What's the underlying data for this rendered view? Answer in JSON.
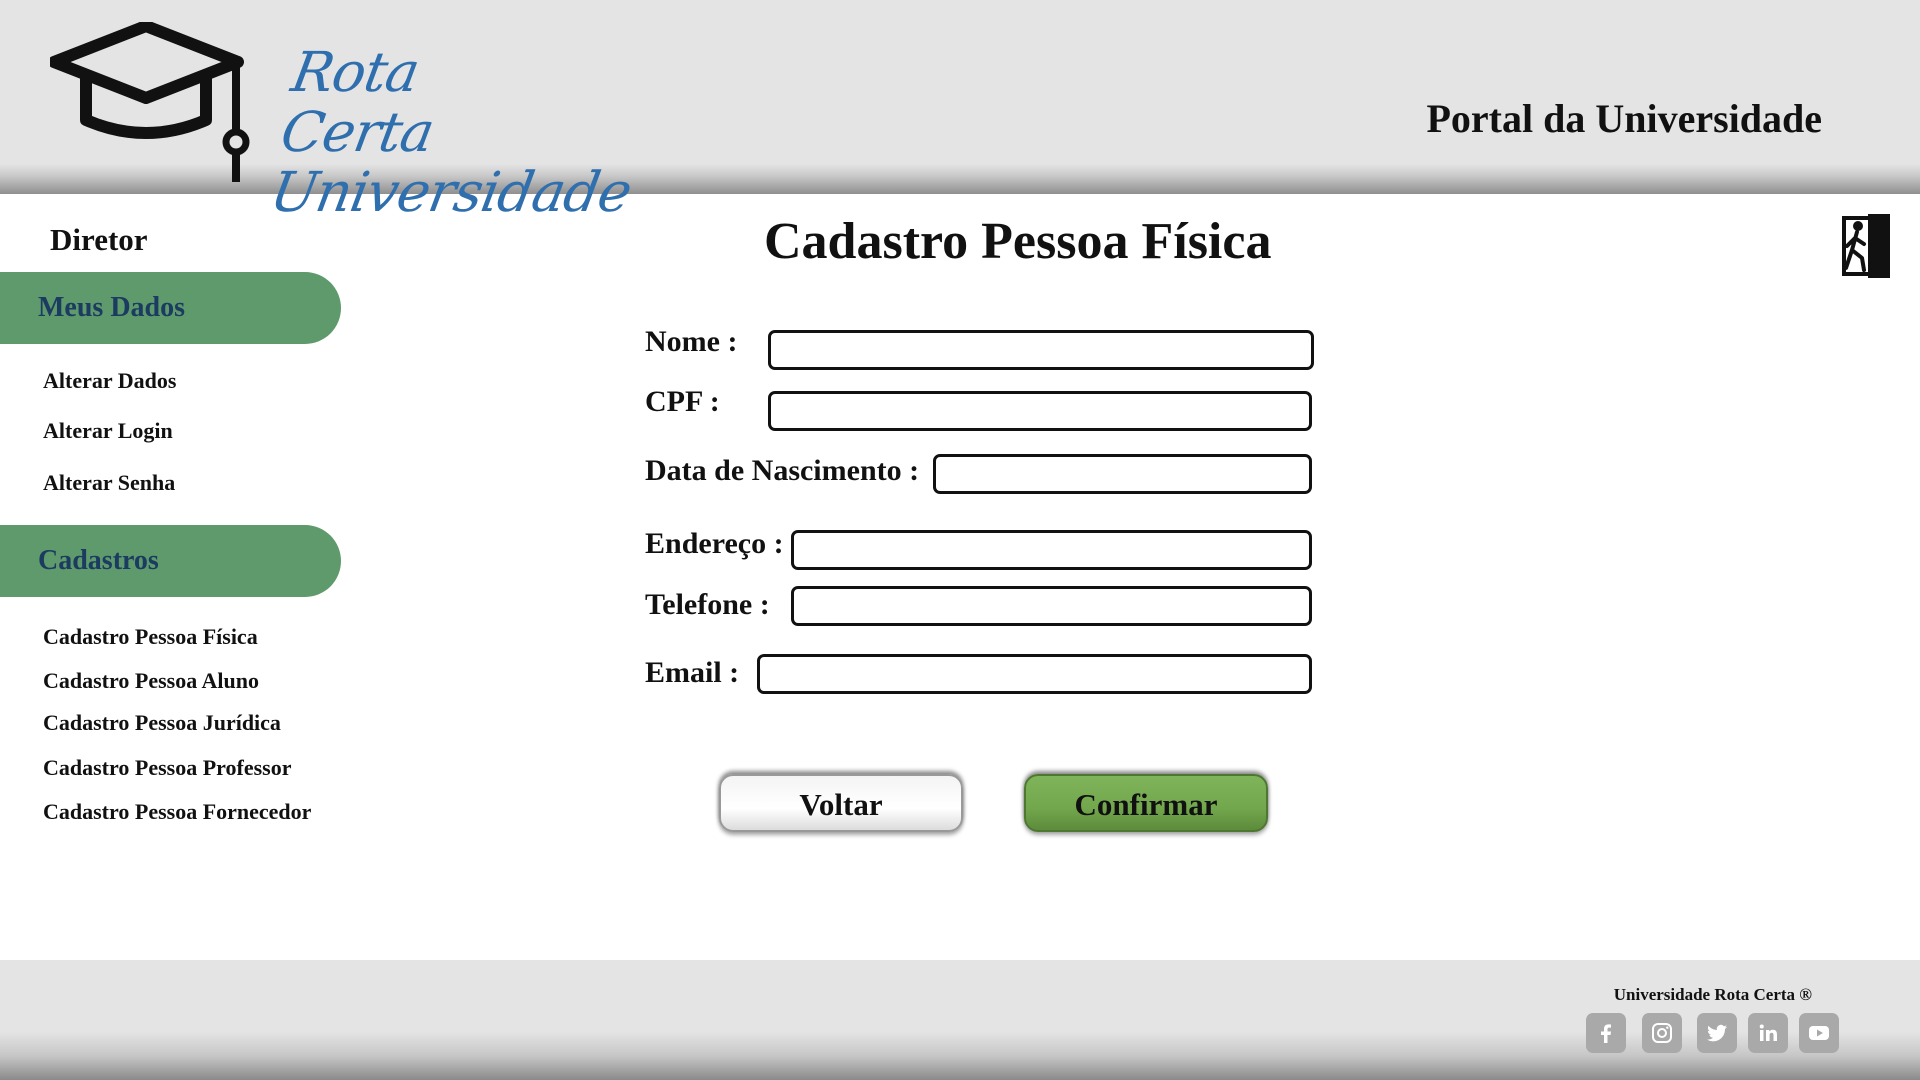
{
  "header": {
    "logo_line1": "Rota Certa",
    "logo_line2": "Universidade",
    "portal_title": "Portal da Universidade"
  },
  "sidebar": {
    "role": "Diretor",
    "sections": [
      {
        "label": "Meus Dados",
        "items": [
          "Alterar Dados",
          "Alterar Login",
          "Alterar Senha"
        ]
      },
      {
        "label": "Cadastros",
        "items": [
          "Cadastro Pessoa Física",
          "Cadastro Pessoa Aluno",
          "Cadastro Pessoa Jurídica",
          "Cadastro Pessoa Professor",
          "Cadastro Pessoa Fornecedor"
        ]
      }
    ]
  },
  "main": {
    "title": "Cadastro Pessoa Física",
    "fields": [
      {
        "label": "Nome :",
        "value": ""
      },
      {
        "label": "CPF :",
        "value": ""
      },
      {
        "label": "Data de Nascimento :",
        "value": ""
      },
      {
        "label": "Endereço :",
        "value": ""
      },
      {
        "label": "Telefone :",
        "value": ""
      },
      {
        "label": "Email :",
        "value": ""
      }
    ],
    "back_label": "Voltar",
    "confirm_label": "Confirmar"
  },
  "footer": {
    "copyright": "Universidade Rota Certa ®",
    "social": [
      "facebook-icon",
      "instagram-icon",
      "twitter-icon",
      "linkedin-icon",
      "youtube-icon"
    ]
  },
  "colors": {
    "sidebar_pill": "#5e9a6c",
    "pill_text": "#1c3b60",
    "logo_blue": "#2f6fae",
    "confirm_green": "#72a74d"
  }
}
